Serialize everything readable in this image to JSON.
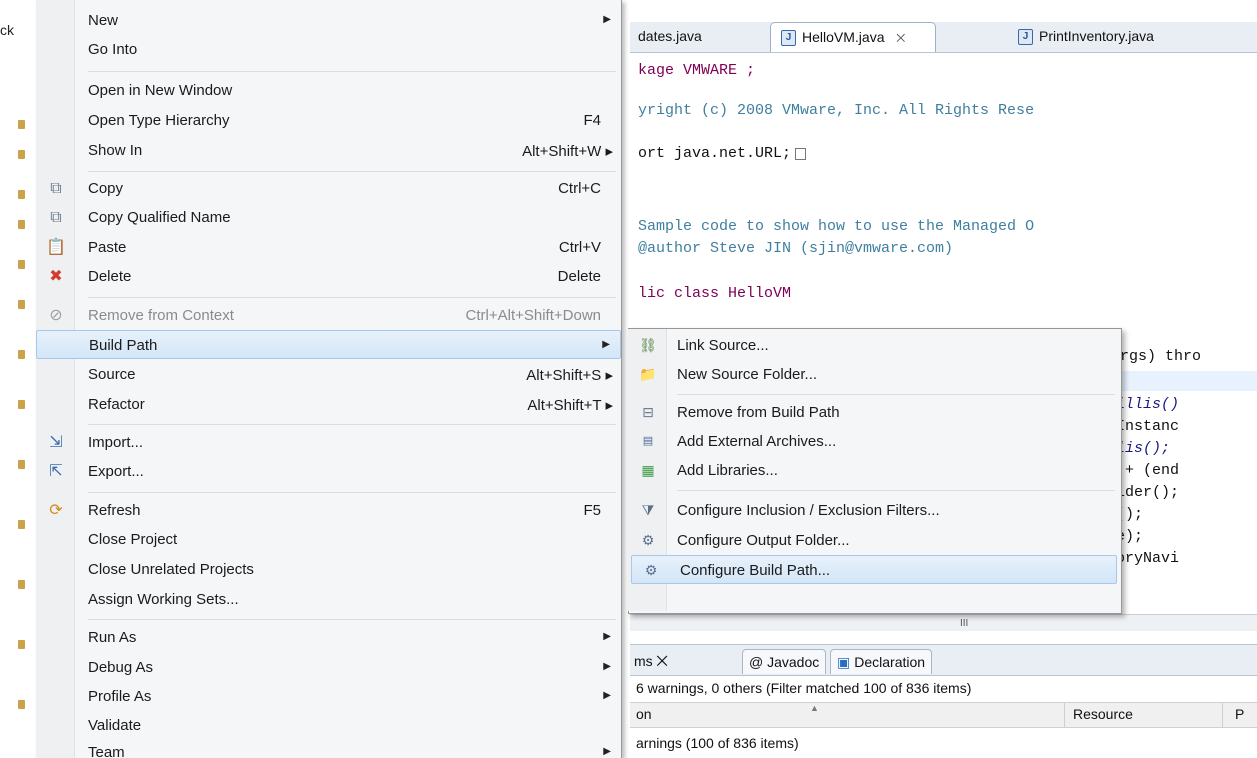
{
  "package_explorer": {
    "fragment": "ck"
  },
  "editor": {
    "tabs": [
      {
        "label": "dates.java"
      },
      {
        "label": "HelloVM.java",
        "close": "⨉"
      },
      {
        "label": "PrintInventory.java"
      }
    ],
    "code_lines": [
      "kage VMWARE ;",
      "yright (c) 2008 VMware, Inc. All Rights Rese",
      "ort java.net.URL;",
      "Sample code to show how to use the Managed O",
      "@author Steve JIN (sjin@vmware.com)",
      "lic class HelloVM",
      "rgs) thro",
      "eMillis()",
      "ceInstanc",
      "illis();",
      ":\" + (end",
      "Folder();",
      "me();",
      "ame);",
      "ntoryNavi",
      ")",
      "{"
    ],
    "scroll_marker": "III"
  },
  "problems_panel": {
    "tabs": [
      "ms ⨉",
      "@ Javadoc",
      "Declaration"
    ],
    "summary": "6 warnings, 0 others (Filter matched 100 of 836 items)",
    "columns": [
      "on",
      "Resource",
      "P"
    ],
    "rows": [
      "arnings (100 of 836 items)"
    ]
  },
  "context_menu": {
    "items": [
      {
        "label": "New",
        "shortcut": "",
        "submenu": true
      },
      {
        "label": "Go Into",
        "shortcut": ""
      },
      {
        "label": "Open in New Window",
        "shortcut": ""
      },
      {
        "label": "Open Type Hierarchy",
        "shortcut": "F4"
      },
      {
        "label": "Show In",
        "shortcut": "Alt+Shift+W ▸"
      },
      {
        "label": "Copy",
        "shortcut": "Ctrl+C",
        "icon": "copy-icon"
      },
      {
        "label": "Copy Qualified Name",
        "shortcut": "",
        "icon": "copy-qualified-icon"
      },
      {
        "label": "Paste",
        "shortcut": "Ctrl+V",
        "icon": "paste-icon"
      },
      {
        "label": "Delete",
        "shortcut": "Delete",
        "icon": "delete-icon"
      },
      {
        "label": "Remove from Context",
        "shortcut": "Ctrl+Alt+Shift+Down",
        "disabled": true
      },
      {
        "label": "Build Path",
        "shortcut": "",
        "submenu": true,
        "highlighted": true
      },
      {
        "label": "Source",
        "shortcut": "Alt+Shift+S ▸"
      },
      {
        "label": "Refactor",
        "shortcut": "Alt+Shift+T ▸"
      },
      {
        "label": "Import...",
        "shortcut": "",
        "icon": "import-icon"
      },
      {
        "label": "Export...",
        "shortcut": "",
        "icon": "export-icon"
      },
      {
        "label": "Refresh",
        "shortcut": "F5",
        "icon": "refresh-icon"
      },
      {
        "label": "Close Project",
        "shortcut": ""
      },
      {
        "label": "Close Unrelated Projects",
        "shortcut": ""
      },
      {
        "label": "Assign Working Sets...",
        "shortcut": ""
      },
      {
        "label": "Run As",
        "shortcut": "",
        "submenu": true
      },
      {
        "label": "Debug As",
        "shortcut": "",
        "submenu": true
      },
      {
        "label": "Profile As",
        "shortcut": "",
        "submenu": true
      },
      {
        "label": "Validate",
        "shortcut": ""
      },
      {
        "label": "Team",
        "shortcut": "",
        "submenu": true
      }
    ]
  },
  "build_path_submenu": {
    "items": [
      {
        "label": "Link Source...",
        "icon": "link-source-icon"
      },
      {
        "label": "New Source Folder...",
        "icon": "new-source-folder-icon"
      },
      {
        "label": "Remove from Build Path",
        "icon": "remove-build-path-icon"
      },
      {
        "label": "Add External Archives...",
        "icon": "archive-icon"
      },
      {
        "label": "Add Libraries...",
        "icon": "library-icon"
      },
      {
        "label": "Configure Inclusion / Exclusion Filters...",
        "icon": "filter-icon"
      },
      {
        "label": "Configure Output Folder...",
        "icon": "output-folder-icon"
      },
      {
        "label": "Configure Build Path...",
        "icon": "build-path-icon",
        "highlighted": true
      }
    ]
  },
  "colors": {
    "menu_bg": "#f5f6f7",
    "highlight": "#d3e6f8",
    "comment": "#3f7f9f",
    "keyword": "#7f0055"
  }
}
